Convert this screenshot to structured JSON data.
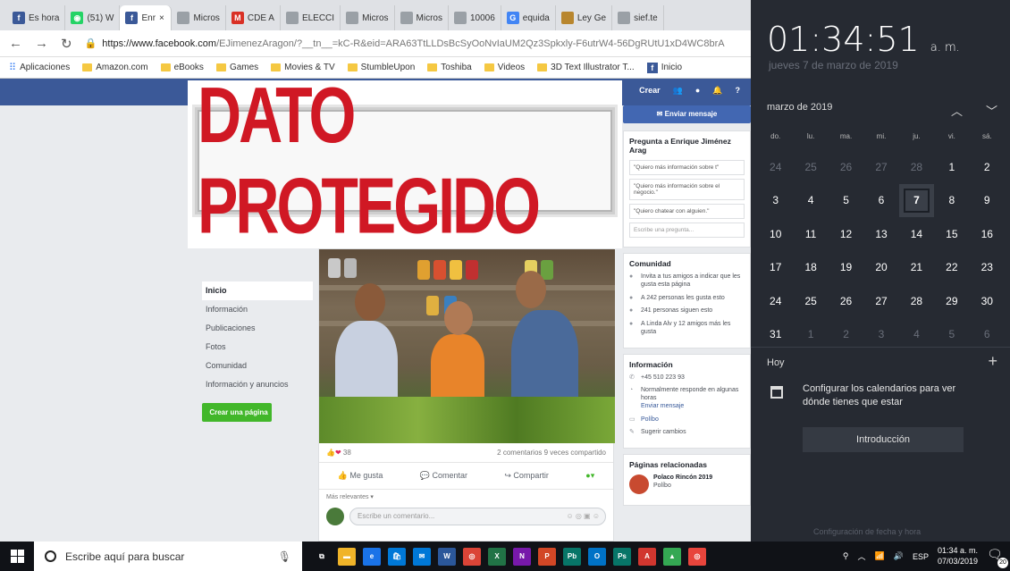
{
  "browser": {
    "tabs": [
      {
        "label": "Es hora",
        "icon": "facebook-icon",
        "color": "#3b5998",
        "glyph": "f"
      },
      {
        "label": "(51) W",
        "icon": "whatsapp-icon",
        "color": "#25d366",
        "glyph": "◉"
      },
      {
        "label": "Enr",
        "icon": "facebook-icon",
        "color": "#3b5998",
        "glyph": "f",
        "active": true
      },
      {
        "label": "Micros",
        "icon": "page-icon",
        "color": "#9aa0a6",
        "glyph": ""
      },
      {
        "label": "CDE A",
        "icon": "gmail-icon",
        "color": "#d93025",
        "glyph": "M"
      },
      {
        "label": "ELECCI",
        "icon": "page-icon",
        "color": "#9aa0a6",
        "glyph": ""
      },
      {
        "label": "Micros",
        "icon": "page-icon",
        "color": "#9aa0a6",
        "glyph": ""
      },
      {
        "label": "Micros",
        "icon": "page-icon",
        "color": "#9aa0a6",
        "glyph": ""
      },
      {
        "label": "10006",
        "icon": "page-icon",
        "color": "#9aa0a6",
        "glyph": ""
      },
      {
        "label": "equida",
        "icon": "google-icon",
        "color": "#4285f4",
        "glyph": "G"
      },
      {
        "label": "Ley Ge",
        "icon": "avatar-icon",
        "color": "#b8862e",
        "glyph": ""
      },
      {
        "label": "sief.te",
        "icon": "page-icon",
        "color": "#9aa0a6",
        "glyph": ""
      }
    ],
    "url_domain": "https://www.facebook.com",
    "url_path": "/EJimenezAragon/?__tn__=kC-R&eid=ARA63TtLLDsBcSyOoNvIaUM2Qz3Spkxly-F6utrW4-56DgRUtU1xD4WC8brA",
    "bookmarks": [
      {
        "label": "Aplicaciones",
        "type": "apps"
      },
      {
        "label": "Amazon.com",
        "type": "folder"
      },
      {
        "label": "eBooks",
        "type": "folder"
      },
      {
        "label": "Games",
        "type": "folder"
      },
      {
        "label": "Movies & TV",
        "type": "folder"
      },
      {
        "label": "StumbleUpon",
        "type": "folder"
      },
      {
        "label": "Toshiba",
        "type": "folder"
      },
      {
        "label": "Videos",
        "type": "folder"
      },
      {
        "label": "3D Text Illustrator T...",
        "type": "folder"
      },
      {
        "label": "Inicio",
        "type": "fb"
      }
    ]
  },
  "facebook": {
    "nav": [
      "Crear",
      "👥",
      "●",
      "🔔",
      "?"
    ],
    "stamp_text": "DATO PROTEGIDO",
    "leftnav": [
      "Inicio",
      "Información",
      "Publicaciones",
      "Fotos",
      "Comunidad",
      "Información y anuncios"
    ],
    "create_page_label": "Crear una página",
    "post": {
      "reactions": "38",
      "counts_text": "2 comentarios  9 veces compartido",
      "like_label": "Me gusta",
      "comment_label": "Comentar",
      "share_label": "Compartir",
      "relevance_label": "Más relevantes ▾",
      "comment_placeholder": "Escribe un comentario..."
    },
    "right": {
      "send_message_label": "Enviar mensaje",
      "ask_title": "Pregunta a Enrique Jiménez Arag",
      "questions": [
        "\"Quiero más información sobre t\"",
        "\"Quiero más información sobre el negocio.\"",
        "\"Quiero chatear con alguien.\""
      ],
      "write_question": "Escribe una pregunta...",
      "community_title": "Comunidad",
      "community_rows": [
        "Invita a tus amigos a indicar que les gusta esta página",
        "A 242 personas les gusta esto",
        "241 personas siguen esto",
        "A Linda Alv y 12 amigos más les gusta"
      ],
      "info_title": "Información",
      "info_rows": [
        "+45 510 223 93",
        "Normalmente responde en algunas horas",
        "Políbo"
      ],
      "send_message_link": "Enviar mensaje",
      "suggest_changes": "Sugerir cambios",
      "related_title": "Páginas relacionadas",
      "related_page": "Polaco Rincón 2019",
      "related_sub": "Políbo"
    }
  },
  "calendar": {
    "time": "01:34:51",
    "ampm": "a. m.",
    "date_long": "jueves 7 de marzo de 2019",
    "month_label": "marzo de 2019",
    "weekdays": [
      "do.",
      "lu.",
      "ma.",
      "mi.",
      "ju.",
      "vi.",
      "sá."
    ],
    "days": [
      {
        "d": "24",
        "dim": true
      },
      {
        "d": "25",
        "dim": true
      },
      {
        "d": "26",
        "dim": true
      },
      {
        "d": "27",
        "dim": true
      },
      {
        "d": "28",
        "dim": true
      },
      {
        "d": "1"
      },
      {
        "d": "2"
      },
      {
        "d": "3"
      },
      {
        "d": "4"
      },
      {
        "d": "5"
      },
      {
        "d": "6"
      },
      {
        "d": "7",
        "today": true
      },
      {
        "d": "8"
      },
      {
        "d": "9"
      },
      {
        "d": "10"
      },
      {
        "d": "11"
      },
      {
        "d": "12"
      },
      {
        "d": "13"
      },
      {
        "d": "14"
      },
      {
        "d": "15"
      },
      {
        "d": "16"
      },
      {
        "d": "17"
      },
      {
        "d": "18"
      },
      {
        "d": "19"
      },
      {
        "d": "20"
      },
      {
        "d": "21"
      },
      {
        "d": "22"
      },
      {
        "d": "23"
      },
      {
        "d": "24"
      },
      {
        "d": "25"
      },
      {
        "d": "26"
      },
      {
        "d": "27"
      },
      {
        "d": "28"
      },
      {
        "d": "29"
      },
      {
        "d": "30"
      },
      {
        "d": "31"
      },
      {
        "d": "1",
        "dim": true
      },
      {
        "d": "2",
        "dim": true
      },
      {
        "d": "3",
        "dim": true
      },
      {
        "d": "4",
        "dim": true
      },
      {
        "d": "5",
        "dim": true
      },
      {
        "d": "6",
        "dim": true
      }
    ],
    "today_label": "Hoy",
    "config_text": "Configurar los calendarios para ver dónde tienes que estar",
    "intro_label": "Introducción",
    "bottom_link": "Configuración de fecha y hora"
  },
  "taskbar": {
    "search_placeholder": "Escribe aquí para buscar",
    "apps": [
      {
        "name": "task-view-icon",
        "color": "#101217",
        "glyph": "⧉"
      },
      {
        "name": "file-explorer-icon",
        "color": "#f0b429",
        "glyph": "▬"
      },
      {
        "name": "edge-icon",
        "color": "#1a73e8",
        "glyph": "e"
      },
      {
        "name": "store-icon",
        "color": "#0078d7",
        "glyph": "🛍"
      },
      {
        "name": "mail-icon",
        "color": "#0078d7",
        "glyph": "✉"
      },
      {
        "name": "word-icon",
        "color": "#2b579a",
        "glyph": "W"
      },
      {
        "name": "chrome-icon",
        "color": "#db4437",
        "glyph": "◎"
      },
      {
        "name": "excel-icon",
        "color": "#217346",
        "glyph": "X"
      },
      {
        "name": "onenote-icon",
        "color": "#7719aa",
        "glyph": "N"
      },
      {
        "name": "powerpoint-icon",
        "color": "#d24726",
        "glyph": "P"
      },
      {
        "name": "publisher-icon",
        "color": "#077568",
        "glyph": "Pb"
      },
      {
        "name": "outlook-icon",
        "color": "#0072c6",
        "glyph": "O"
      },
      {
        "name": "publisher2-icon",
        "color": "#077568",
        "glyph": "Ps"
      },
      {
        "name": "acrobat-icon",
        "color": "#d1362f",
        "glyph": "A"
      },
      {
        "name": "maps-icon",
        "color": "#34a853",
        "glyph": "▲"
      },
      {
        "name": "chrome2-icon",
        "color": "#e8453c",
        "glyph": "◎"
      }
    ],
    "language": "ESP",
    "time": "01:34 a. m.",
    "date": "07/03/2019",
    "notif_count": "20"
  }
}
